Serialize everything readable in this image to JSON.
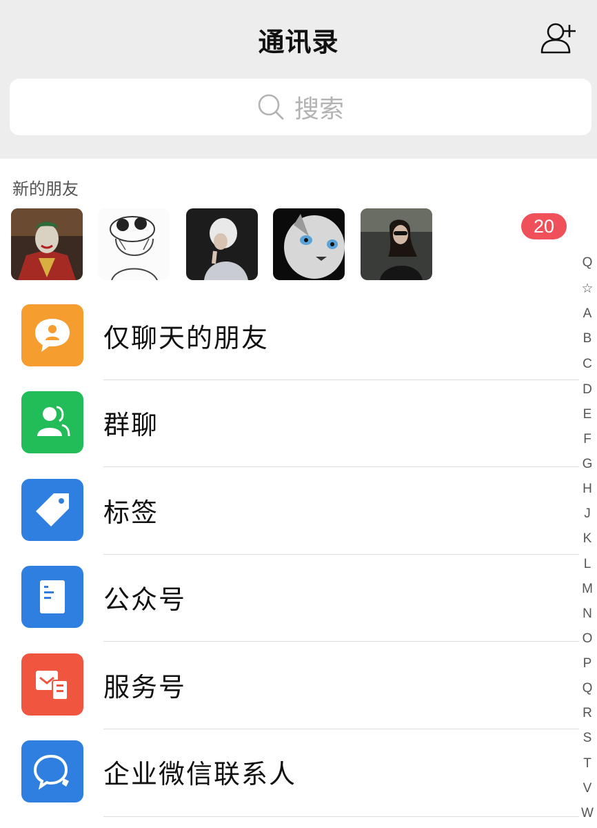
{
  "header": {
    "title": "通讯录",
    "add_icon": "add-friend-icon",
    "search_placeholder": "搜索",
    "search_icon": "search-icon"
  },
  "new_friends": {
    "label": "新的朋友",
    "badge": "20",
    "badge_color": "#f0505a",
    "avatars": [
      {
        "name": "joker"
      },
      {
        "name": "anime-sketch"
      },
      {
        "name": "white-hair-person"
      },
      {
        "name": "cat-closeup"
      },
      {
        "name": "woman-sunglasses"
      }
    ]
  },
  "menu": [
    {
      "label": "仅聊天的朋友",
      "icon": "chat-only-friends-icon",
      "color": "#f59d2e"
    },
    {
      "label": "群聊",
      "icon": "group-chat-icon",
      "color": "#22bd58"
    },
    {
      "label": "标签",
      "icon": "tag-icon",
      "color": "#2f7fe0"
    },
    {
      "label": "公众号",
      "icon": "official-accounts-icon",
      "color": "#2f7fe0"
    },
    {
      "label": "服务号",
      "icon": "service-accounts-icon",
      "color": "#f0563f"
    },
    {
      "label": "企业微信联系人",
      "icon": "wecom-contacts-icon",
      "color": "#2f7fe0"
    }
  ],
  "index_bar": [
    "Q",
    "☆",
    "A",
    "B",
    "C",
    "D",
    "E",
    "F",
    "G",
    "H",
    "J",
    "K",
    "L",
    "M",
    "N",
    "O",
    "P",
    "Q",
    "R",
    "S",
    "T",
    "V",
    "W"
  ]
}
